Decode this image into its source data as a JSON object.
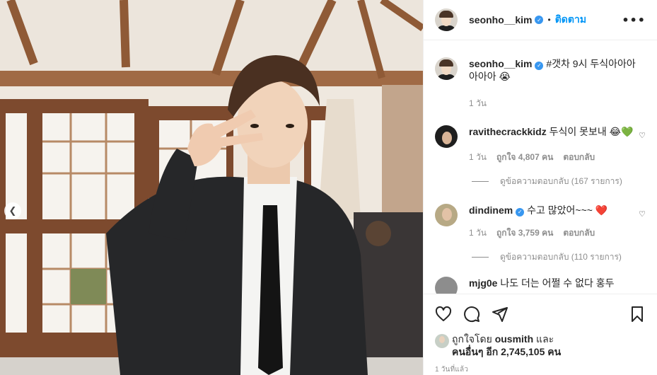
{
  "post": {
    "author": "seonho__kim",
    "follow_label": "ติดตาม",
    "more_label": "•••"
  },
  "caption": {
    "username": "seonho__kim",
    "text": "#갯차 9시 두식아아아아아아 😭",
    "time": "1 วัน"
  },
  "comments": [
    {
      "username": "ravithecrackkidz",
      "text": "두식이 못보내 😂💚",
      "time": "1 วัน",
      "likes": "ถูกใจ 4,807 คน",
      "reply_label": "ตอบกลับ",
      "view_replies": "ดูข้อความตอบกลับ (167 รายการ)"
    },
    {
      "username": "dindinem",
      "text": "수고 많았어~~~ ❤️",
      "time": "1 วัน",
      "likes": "ถูกใจ 3,759 คน",
      "reply_label": "ตอบกลับ",
      "view_replies": "ดูข้อความตอบกลับ (110 รายการ)"
    },
    {
      "username": "mjg0e",
      "text": "나도 더는 어쩔 수 없다 홍두"
    }
  ],
  "likes": {
    "prefix": "ถูกใจโดย",
    "user": "ousmith",
    "and": "และ",
    "others": "คนอื่นๆ อีก 2,745,105 คน"
  },
  "timestamp": "1 วันที่แล้ว",
  "icons": {
    "like": "heart-icon",
    "comment": "comment-icon",
    "share": "share-icon",
    "save": "bookmark-icon",
    "prev": "chevron-left-icon"
  },
  "colors": {
    "accent": "#0095f6",
    "verified": "#3897f0",
    "muted": "#8e8e8e",
    "heart_red": "#ed4956",
    "heart_green": "#3ecb3e"
  }
}
